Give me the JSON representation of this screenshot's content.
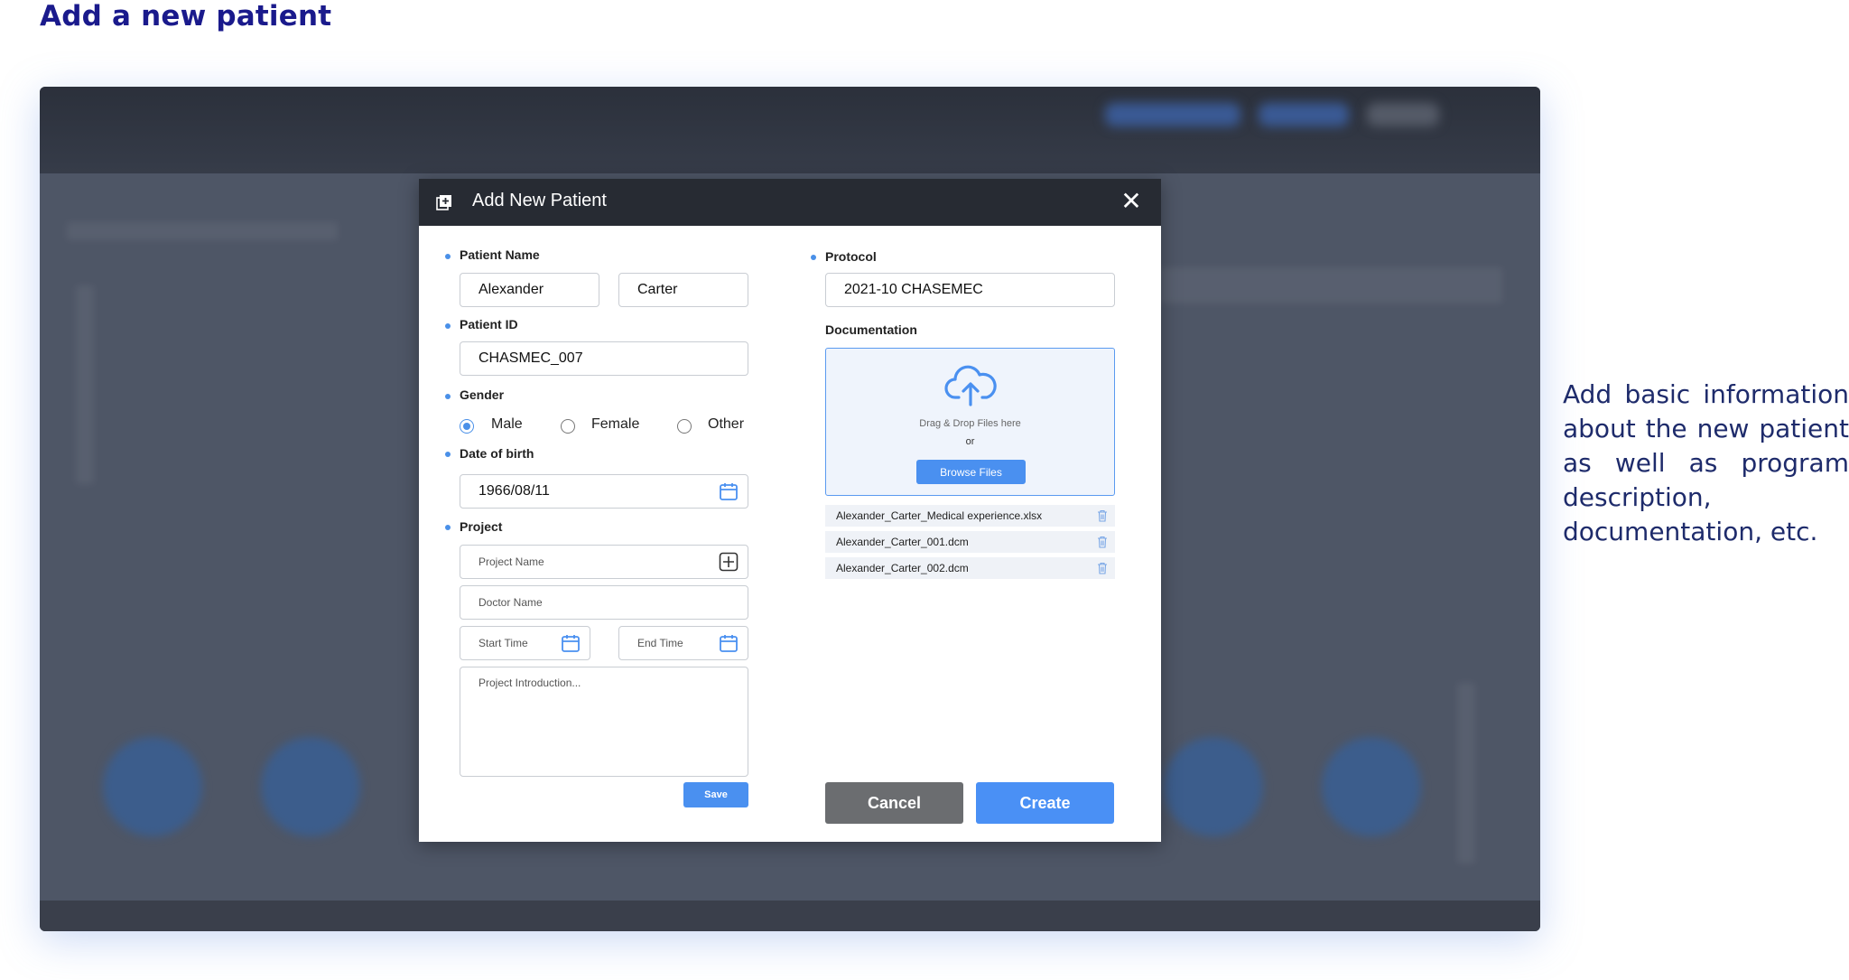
{
  "page": {
    "heading": "Add a new patient",
    "note": "Add basic information about the new patient as well as program description, documentation, etc."
  },
  "modal": {
    "title": "Add New Patient",
    "close_label": "✕"
  },
  "form": {
    "patient_name_label": "Patient Name",
    "first_name": "Alexander",
    "last_name": "Carter",
    "patient_id_label": "Patient ID",
    "patient_id": "CHASMEC_007",
    "gender_label": "Gender",
    "gender_options": [
      "Male",
      "Female",
      "Other"
    ],
    "gender_selected": "Male",
    "dob_label": "Date of birth",
    "dob": "1966/08/11",
    "project_label": "Project",
    "project_name_placeholder": "Project Name",
    "doctor_name_placeholder": "Doctor Name",
    "start_time_placeholder": "Start Time",
    "end_time_placeholder": "End Time",
    "project_intro_placeholder": "Project Introduction...",
    "save_label": "Save"
  },
  "right": {
    "protocol_label": "Protocol",
    "protocol": "2021-10 CHASEMEC",
    "documentation_label": "Documentation",
    "drop_text": "Drag & Drop Files here",
    "or_text": "or",
    "browse_label": "Browse Files",
    "files": [
      "Alexander_Carter_Medical experience.xlsx",
      "Alexander_Carter_001.dcm",
      "Alexander_Carter_002.dcm"
    ],
    "cancel_label": "Cancel",
    "create_label": "Create"
  },
  "colors": {
    "accent": "#4a90f0",
    "header": "#272b33",
    "heading": "#1a1a8c",
    "cancel": "#6b6d70"
  },
  "icons": [
    "add-patient-icon",
    "close-icon",
    "calendar-icon",
    "plus-box-icon",
    "cloud-upload-icon",
    "trash-icon"
  ]
}
